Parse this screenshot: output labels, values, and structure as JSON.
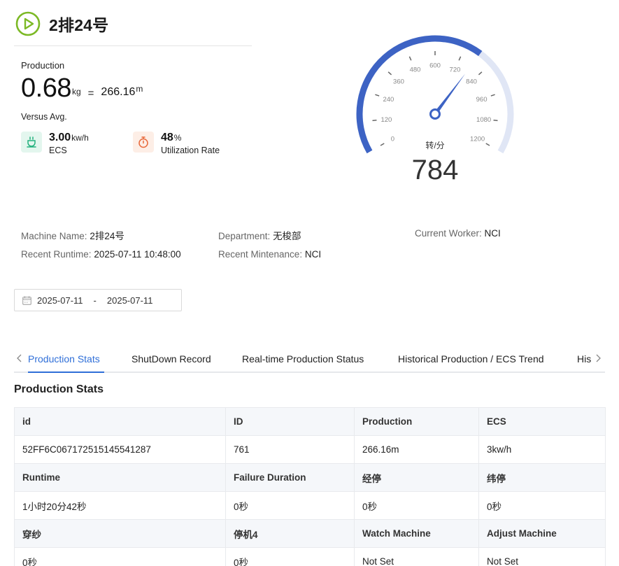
{
  "header": {
    "title": "2排24号",
    "accent": "#7cb925"
  },
  "production": {
    "label": "Production",
    "value": "0.68",
    "unit": "kg",
    "equals": "=",
    "length_value": "266.16",
    "length_unit": "m",
    "versus_label": "Versus Avg."
  },
  "metrics": [
    {
      "value": "3.00",
      "unit": "kw/h",
      "label": "ECS",
      "icon": "cup-icon",
      "color": "#22b07d"
    },
    {
      "value": "48",
      "unit": "%",
      "label": "Utilization Rate",
      "icon": "stopwatch-icon",
      "color": "#e8683a"
    }
  ],
  "gauge": {
    "min": 0,
    "max": 1200,
    "value": 784,
    "value_label": "784",
    "unit_label": "转/分",
    "ticks": [
      "0",
      "120",
      "240",
      "360",
      "480",
      "600",
      "720",
      "840",
      "960",
      "1080",
      "1200"
    ],
    "arc_color": "#3d63c4",
    "track_color": "#e0e6f5"
  },
  "info": [
    {
      "key": "Machine Name:",
      "value": "2排24号"
    },
    {
      "key": "Department:",
      "value": "无梭部"
    },
    {
      "key": "Current Worker:",
      "value": "NCI"
    },
    {
      "key": "Recent Runtime:",
      "value": "2025-07-11 10:48:00"
    },
    {
      "key": "Recent Mintenance:",
      "value": "NCI"
    }
  ],
  "date_range": {
    "start": "2025-07-11",
    "separator": "-",
    "end": "2025-07-11"
  },
  "tabs": [
    {
      "label": "Production Stats",
      "active": true
    },
    {
      "label": "ShutDown Record"
    },
    {
      "label": "Real-time Production Status"
    },
    {
      "label": "Historical Production / ECS Trend"
    },
    {
      "label": "His"
    }
  ],
  "section_title": "Production Stats",
  "table": [
    [
      "id",
      "ID",
      "Production",
      "ECS"
    ],
    [
      "52FF6C067172515145541287",
      "761",
      "266.16m",
      "3kw/h"
    ],
    [
      "Runtime",
      "Failure Duration",
      "经停",
      "纬停"
    ],
    [
      "1小时20分42秒",
      "0秒",
      "0秒",
      "0秒"
    ],
    [
      "穿纱",
      "停机4",
      "Watch Machine",
      "Adjust Machine"
    ],
    [
      "0秒",
      "0秒",
      "Not Set",
      "Not Set"
    ]
  ]
}
